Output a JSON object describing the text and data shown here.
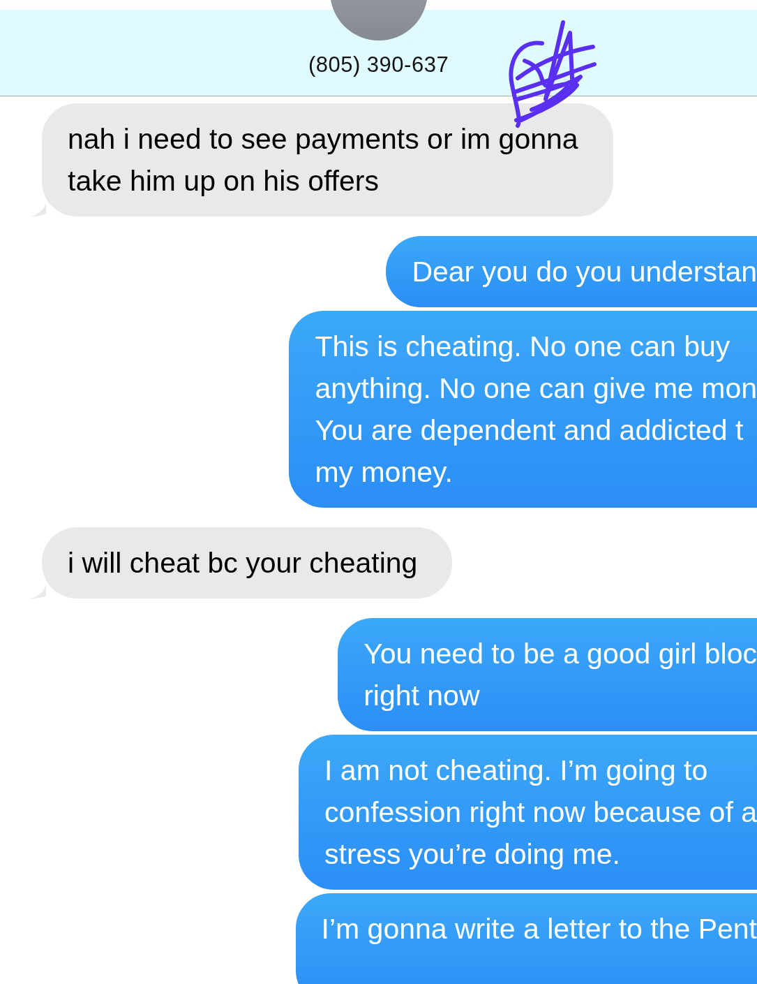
{
  "header": {
    "contact": "(805) 390-637"
  },
  "messages": [
    {
      "kind": "received",
      "lines": [
        "nah i need to see payments or im gonna",
        "take him up on his offers"
      ]
    },
    {
      "kind": "sent",
      "lines": [
        "Dear you do you understan"
      ]
    },
    {
      "kind": "sent",
      "lines": [
        "This is cheating. No one can buy",
        "anything. No one can give me mon",
        "You are dependent and addicted t",
        "my money."
      ]
    },
    {
      "kind": "received",
      "lines": [
        "i will cheat bc your cheating"
      ]
    },
    {
      "kind": "sent",
      "lines": [
        "You need to be a good girl bloc",
        "right now"
      ]
    },
    {
      "kind": "sent",
      "lines": [
        "I am not cheating. I’m going to",
        "confession right now because of a",
        "stress you’re doing me."
      ]
    },
    {
      "kind": "sent",
      "lines": [
        "I’m gonna write a letter to the Pent"
      ]
    }
  ]
}
